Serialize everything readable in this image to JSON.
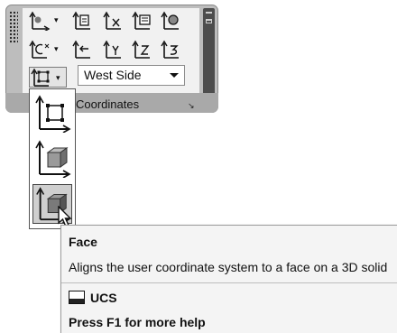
{
  "panel": {
    "title": "Coordinates",
    "view_select": {
      "value": "West Side"
    },
    "launcher_glyph": "↘"
  },
  "tools": {
    "row1": [
      "ucs-origin-icon",
      "ucs-named-icon",
      "ucs-x-icon",
      "ucs-view-icon",
      "ucs-world-icon"
    ],
    "row2": [
      "ucs-zaxis-icon",
      "ucs-previous-icon",
      "ucs-y-icon",
      "ucs-z-icon",
      "ucs-3point-icon"
    ],
    "row3_split": "ucs-face-icon"
  },
  "flyout": {
    "items": [
      "ucs-object-icon",
      "ucs-box-icon",
      "ucs-face-icon"
    ],
    "active_index": 2
  },
  "tooltip": {
    "title": "Face",
    "description": "Aligns the user coordinate system to a face on a 3D solid",
    "command": "UCS",
    "help": "Press F1 for more help"
  }
}
